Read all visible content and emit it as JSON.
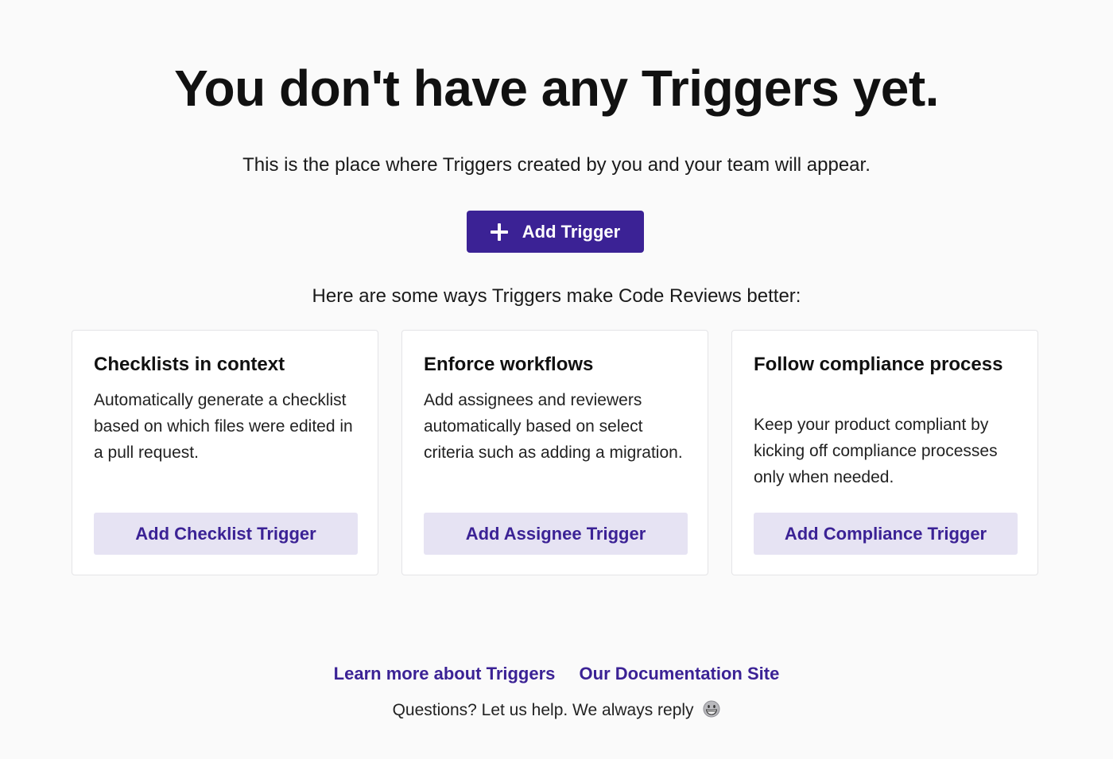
{
  "header": {
    "title": "You don't have any Triggers yet.",
    "subtitle": "This is the place where Triggers created by you and your team will appear."
  },
  "primary_action": {
    "label": "Add Trigger",
    "icon": "plus-icon",
    "color": "#3b2295"
  },
  "ways_heading": "Here are some ways Triggers make Code Reviews better:",
  "cards": [
    {
      "title": "Checklists in context",
      "description": "Automatically generate a checklist based on which files were edited in a pull request.",
      "button": "Add Checklist Trigger"
    },
    {
      "title": "Enforce workflows",
      "description": "Add assignees and reviewers automatically based on select criteria such as adding a migration.",
      "button": "Add Assignee Trigger"
    },
    {
      "title": "Follow compliance process",
      "description": "Keep your product compliant by kicking off compliance processes only when needed.",
      "button": "Add Compliance Trigger"
    }
  ],
  "footer": {
    "links": [
      "Learn more about Triggers",
      "Our Documentation Site"
    ],
    "help_text": "Questions? Let us help. We always reply",
    "help_icon": "grinning-face-icon"
  },
  "colors": {
    "accent": "#3b2295",
    "secondary_button_bg": "#e6e3f3",
    "background": "#fafafa"
  }
}
